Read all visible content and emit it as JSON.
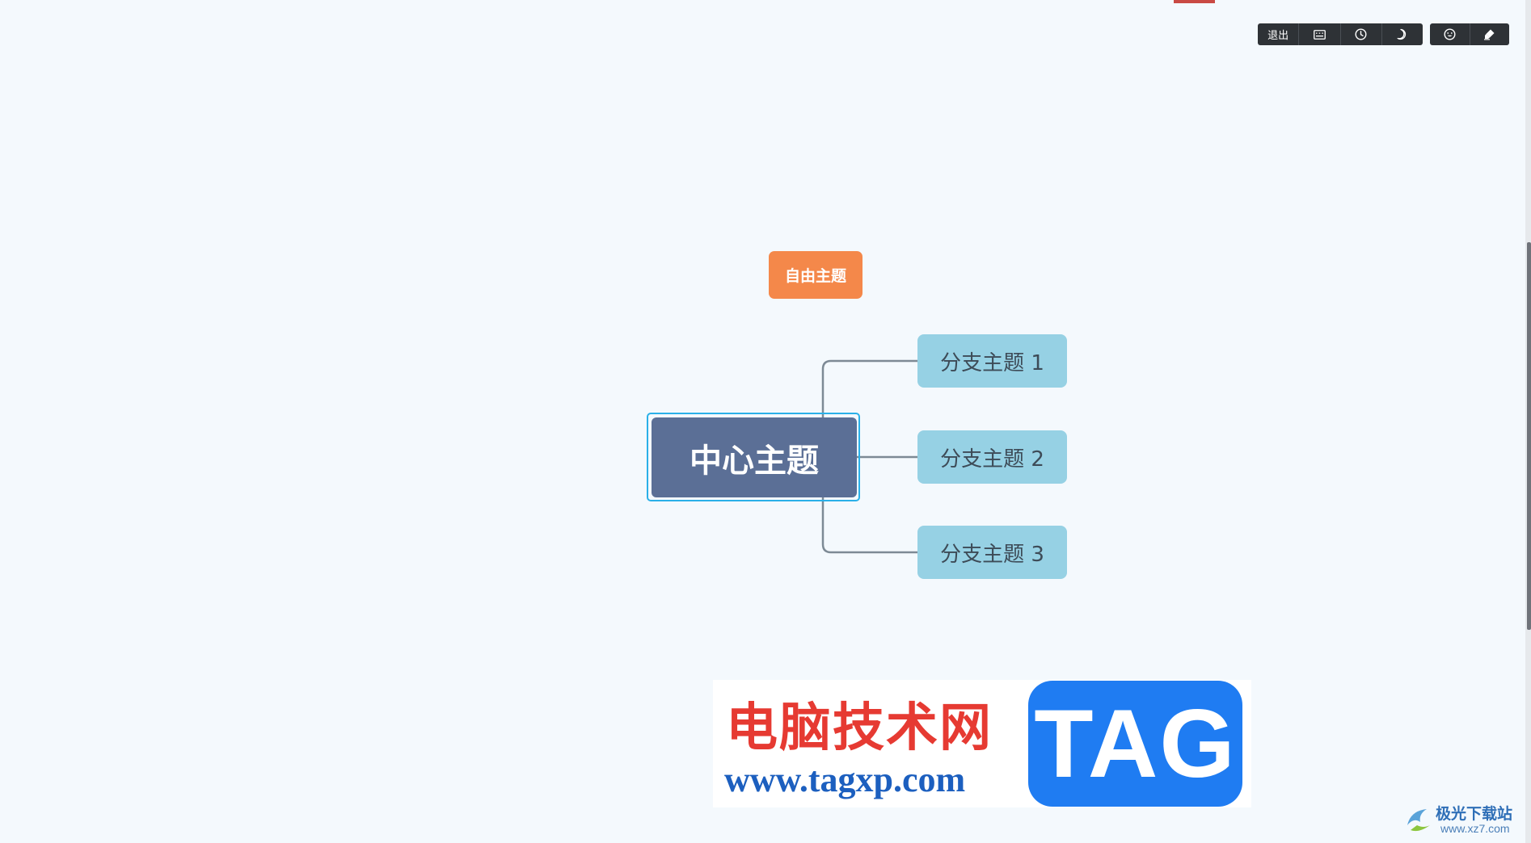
{
  "toolbar": {
    "exit_label": "退出",
    "icons": [
      "keyboard-icon",
      "clock-icon",
      "moon-icon",
      "emoji-icon",
      "highlighter-icon"
    ]
  },
  "mindmap": {
    "free_topic": "自由主题",
    "central_topic": "中心主题",
    "branches": [
      "分支主题 1",
      "分支主题 2",
      "分支主题 3"
    ]
  },
  "watermark": {
    "site_name": "电脑技术网",
    "site_url": "www.tagxp.com",
    "tag_text": "TAG",
    "corner_name": "极光下载站",
    "corner_url": "www.xz7.com"
  },
  "colors": {
    "background": "#f4f9fd",
    "central": "#5b6f96",
    "branch": "#96d1e4",
    "free": "#f4884a",
    "selection": "#2ab0e8",
    "toolbar": "#2e3236"
  }
}
